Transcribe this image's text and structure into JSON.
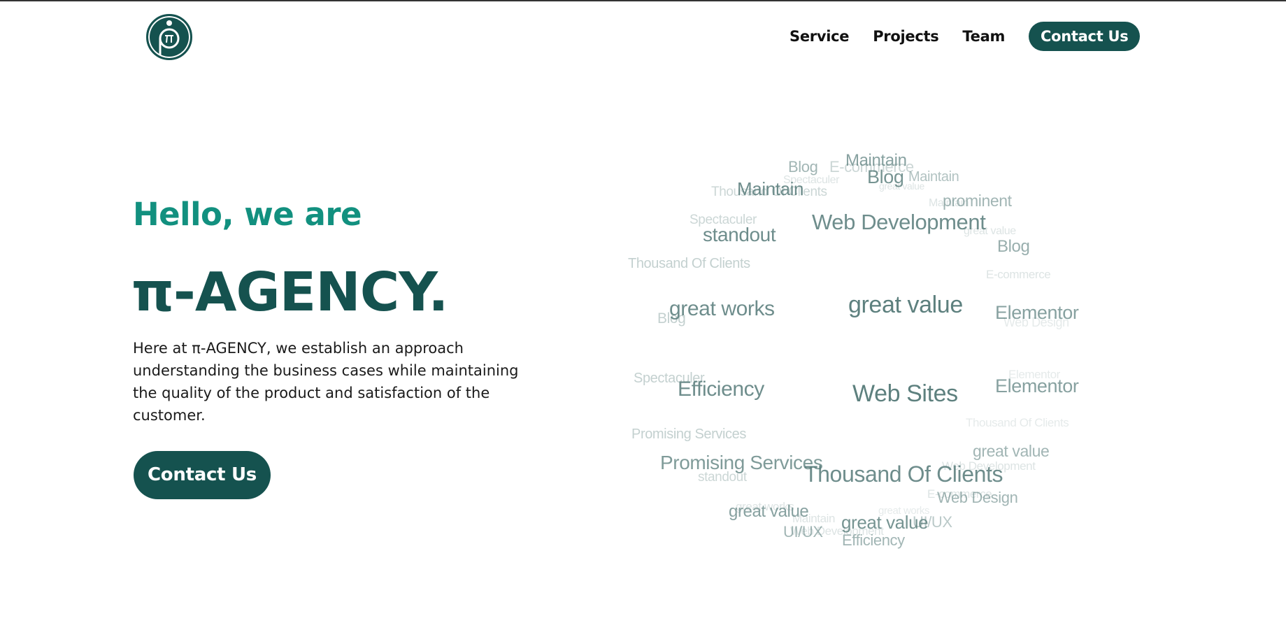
{
  "nav": {
    "links": [
      "Service",
      "Projects",
      "Team"
    ],
    "contact_label": "Contact Us"
  },
  "hero": {
    "greeting": "Hello, we are",
    "title": "π-AGENCY.",
    "description": "Here at π-AGENCY, we establish an approach understanding the business cases while maintaining the quality of the product and satisfaction of the customer.",
    "cta_label": "Contact Us"
  },
  "tag_cloud": {
    "tags": [
      "Maintain",
      "Blog",
      "E-commerce",
      "Blog",
      "Maintain",
      "Spectaculer",
      "Maintain",
      "Thousand Of Clients",
      "great value",
      "prominent",
      "Maintain",
      "Spectaculer",
      "Web Development",
      "standout",
      "great value",
      "Blog",
      "Thousand Of Clients",
      "E-commerce",
      "great works",
      "great value",
      "Blog",
      "Elementor",
      "Web Design",
      "Spectaculer",
      "Efficiency",
      "Web Sites",
      "Elementor",
      "Elementor",
      "Thousand Of Clients",
      "Promising Services",
      "great value",
      "Promising Services",
      "Web Development",
      "Thousand Of Clients",
      "standout",
      "E-commerce",
      "Web Design",
      "great works",
      "great value",
      "great works",
      "Maintain",
      "UI/UX",
      "great value",
      "Web Development",
      "UI/UX",
      "Efficiency"
    ]
  },
  "colors": {
    "brand_dark": "#15524f",
    "brand_teal": "#12907f",
    "tag_color": "#557a78"
  }
}
